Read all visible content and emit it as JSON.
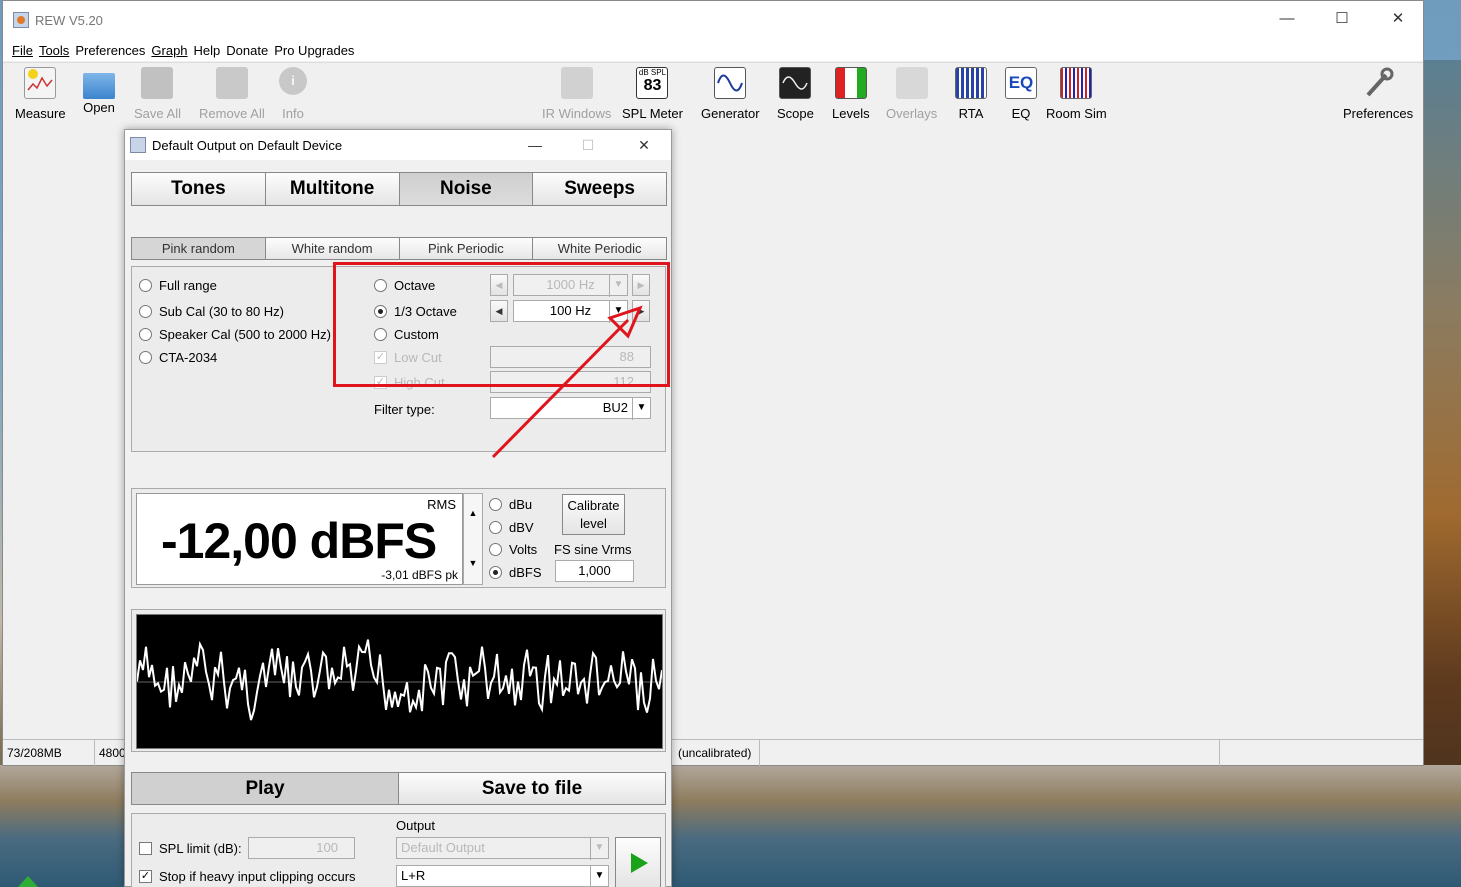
{
  "app": {
    "title": "REW V5.20",
    "menu": [
      "File",
      "Tools",
      "Preferences",
      "Graph",
      "Help",
      "Donate",
      "Pro Upgrades"
    ],
    "menu_underline_first": [
      true,
      true,
      false,
      true,
      false,
      false,
      false
    ]
  },
  "toolbar": {
    "measure": "Measure",
    "open": "Open",
    "save_all": "Save All",
    "remove_all": "Remove All",
    "info": "Info",
    "ir_windows": "IR Windows",
    "spl_meter": "SPL Meter",
    "spl_meter_icon_label": "dB SPL",
    "spl_meter_icon_value": "83",
    "generator": "Generator",
    "scope": "Scope",
    "levels": "Levels",
    "overlays": "Overlays",
    "rta": "RTA",
    "eq": "EQ",
    "eq_icon_text": "EQ",
    "room_sim": "Room Sim",
    "preferences": "Preferences"
  },
  "status_bar": {
    "memory": "73/208MB",
    "rate": "4800",
    "calibration": "(uncalibrated)"
  },
  "generator": {
    "title": "Default Output on Default Device",
    "tabs": [
      "Tones",
      "Multitone",
      "Noise",
      "Sweeps"
    ],
    "active_tab": "Noise",
    "noise_types": [
      "Pink random",
      "White random",
      "Pink Periodic",
      "White Periodic"
    ],
    "active_noise_type": "Pink random",
    "range_options": [
      "Full range",
      "Sub Cal (30 to 80 Hz)",
      "Speaker Cal (500 to 2000 Hz)",
      "CTA-2034"
    ],
    "band_options": [
      "Octave",
      "1/3 Octave",
      "Custom"
    ],
    "selected_band": "1/3 Octave",
    "octave_value": "1000 Hz",
    "third_octave_value": "100 Hz",
    "low_cut_label": "Low Cut",
    "low_cut_value": "88",
    "high_cut_label": "High Cut",
    "high_cut_value": "112",
    "filter_type_label": "Filter type:",
    "filter_type_value": "BU2",
    "level": {
      "rms_label": "RMS",
      "value": "-12,00 dBFS",
      "peak": "-3,01 dBFS pk",
      "units": [
        "dBu",
        "dBV",
        "Volts",
        "dBFS"
      ],
      "selected_unit": "dBFS",
      "calibrate_label_line1": "Calibrate",
      "calibrate_label_line2": "level",
      "fs_sine_label": "FS sine Vrms",
      "fs_sine_value": "1,000"
    },
    "play_label": "Play",
    "save_label": "Save to file",
    "spl_limit_label": "SPL limit (dB):",
    "spl_limit_value": "100",
    "stop_clipping_label": "Stop if heavy input clipping occurs",
    "output_label": "Output",
    "output_device": "Default Output",
    "output_channel": "L+R"
  },
  "colors": {
    "annotation": "#e0141c",
    "play_green": "#1aa31a"
  }
}
